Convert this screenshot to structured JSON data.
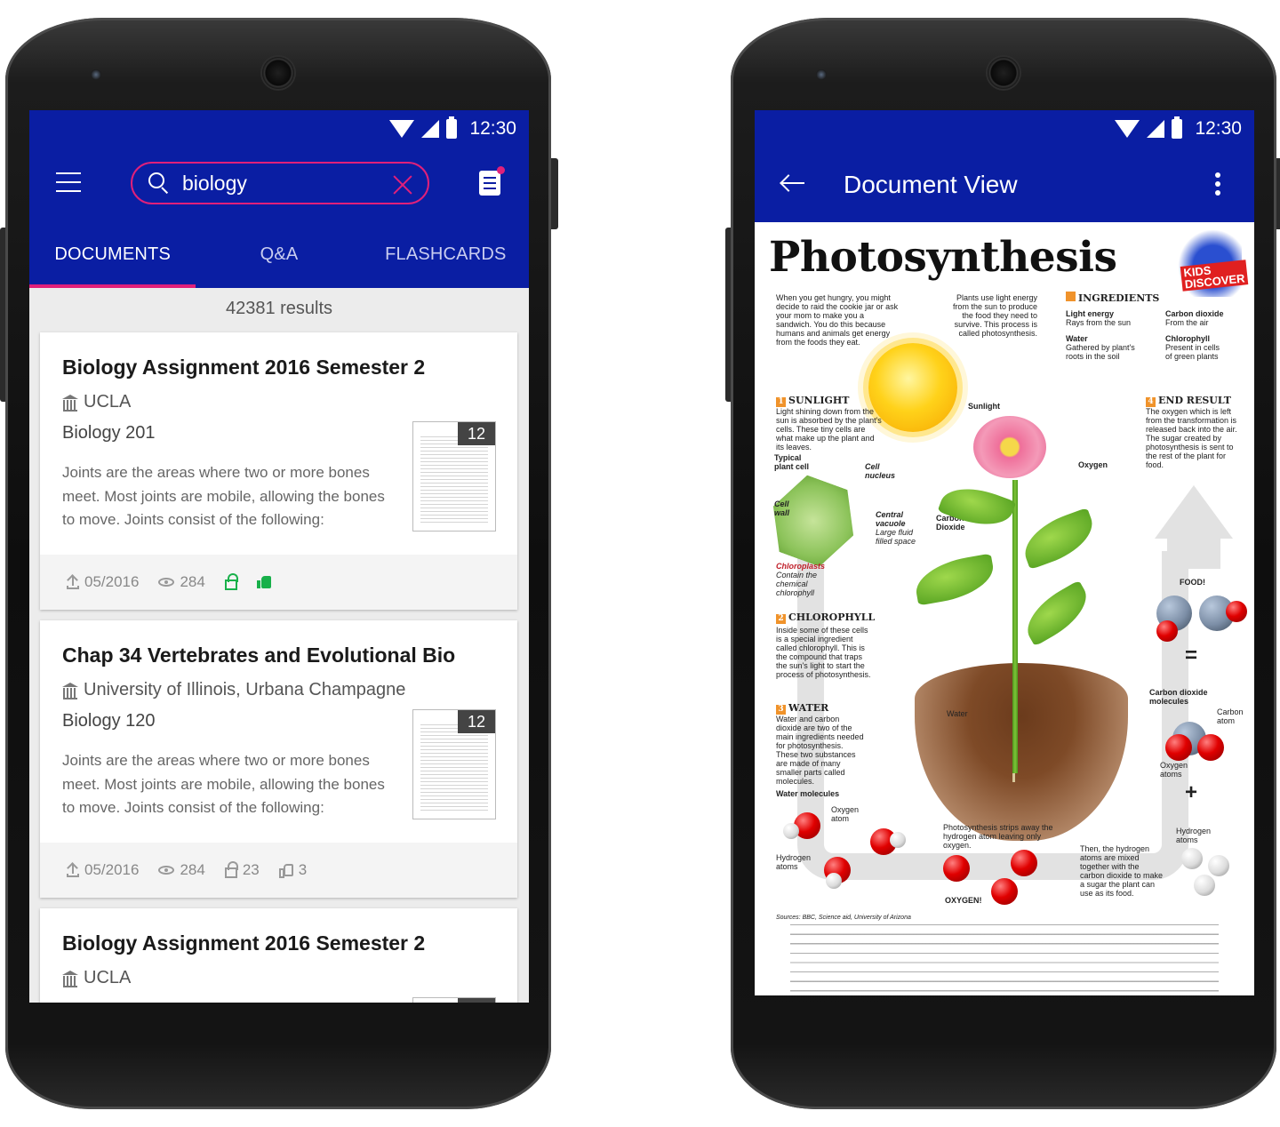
{
  "status_bar": {
    "time": "12:30"
  },
  "search_screen": {
    "search": {
      "value": "biology"
    },
    "tabs": [
      {
        "label": "DOCUMENTS",
        "active": true
      },
      {
        "label": "Q&A",
        "active": false
      },
      {
        "label": "FLASHCARDS",
        "active": false
      }
    ],
    "results_count": "42381 results",
    "cards": [
      {
        "title": "Biology Assignment 2016 Semester 2",
        "school": "UCLA",
        "course": "Biology 201",
        "description": "Joints are the areas where two or more bones meet. Most joints are mobile, allowing the bones to move. Joints consist of the following:",
        "pages": "12",
        "date": "05/2016",
        "views": "284",
        "unlocked": true,
        "liked": true
      },
      {
        "title": "Chap 34 Vertebrates and Evolutional Bio",
        "school": "University of Illinois, Urbana Champagne",
        "course": "Biology 120",
        "description": "Joints are the areas where two or more bones meet. Most joints are mobile, allowing the bones to move. Joints consist of the following:",
        "pages": "12",
        "date": "05/2016",
        "views": "284",
        "unlocks": "23",
        "likes": "3"
      },
      {
        "title": "Biology Assignment 2016 Semester 2",
        "school": "UCLA"
      }
    ]
  },
  "document_screen": {
    "title": "Document View",
    "document": {
      "heading": "Photosynthesis",
      "logo_text": "KIDS DISCOVER",
      "intro_left": "When you get hungry, you might decide to raid the cookie jar or ask your mom to make you a sandwich. You do this because humans and animals get energy from the foods they eat.",
      "intro_right": "Plants use light energy from the sun to produce the food they need to survive. This process is called photosynthesis.",
      "ingredients_heading": "INGREDIENTS",
      "ingredients": [
        {
          "name": "Light energy",
          "detail": "Rays from the sun"
        },
        {
          "name": "Carbon dioxide",
          "detail": "From the air"
        },
        {
          "name": "Water",
          "detail": "Gathered by plant's roots in the soil"
        },
        {
          "name": "Chlorophyll",
          "detail": "Present in cells of green plants"
        }
      ],
      "sections": [
        {
          "num": "1",
          "heading": "SUNLIGHT",
          "text": "Light shining down from the sun is absorbed by the plant's cells. These tiny cells are what make up the plant and its leaves."
        },
        {
          "num": "2",
          "heading": "CHLOROPHYLL",
          "text": "Inside some of these cells is a special ingredient called chlorophyll. This is the compound that traps the sun's light to start the process of photosynthesis."
        },
        {
          "num": "3",
          "heading": "WATER",
          "text": "Water and carbon dioxide are two of the main ingredients needed for photosynthesis. These two substances are made of many smaller parts called molecules."
        },
        {
          "num": "4",
          "heading": "END RESULT",
          "text": "The oxygen which is left from the transformation is released back into the air. The sugar created by photosynthesis is sent to the rest of the plant for food."
        }
      ],
      "labels": {
        "sunlight": "Sunlight",
        "oxygen": "Oxygen",
        "carbon_dioxide": "Carbon Dioxide",
        "typical_cell": "Typical plant cell",
        "cell_nucleus": "Cell nucleus",
        "cell_wall": "Cell wall",
        "central_vacuole": "Central vacuole",
        "vacuole_note": "Large fluid filled space",
        "chloroplasts": "Chloroplasts",
        "chloroplasts_note": "Contain the chemical chlorophyll",
        "water": "Water",
        "water_molecules": "Water molecules",
        "oxygen_atom": "Oxygen atom",
        "hydrogen_atoms": "Hydrogen atoms",
        "strip_note": "Photosynthesis strips away the hydrogen atom leaving only oxygen.",
        "oxygen_caption": "OXYGEN!",
        "food": "FOOD!",
        "co2_molecules": "Carbon dioxide molecules",
        "carbon_atom": "Carbon atom",
        "oxygen_atoms": "Oxygen atoms",
        "hydrogen_atoms_2": "Hydrogen atoms",
        "mix_note": "Then, the hydrogen atoms are mixed together with the carbon dioxide to make a sugar the plant can use as its food.",
        "sources": "Sources: BBC, Science aid, University of Arizona",
        "equals": "=",
        "plus": "+"
      }
    }
  }
}
